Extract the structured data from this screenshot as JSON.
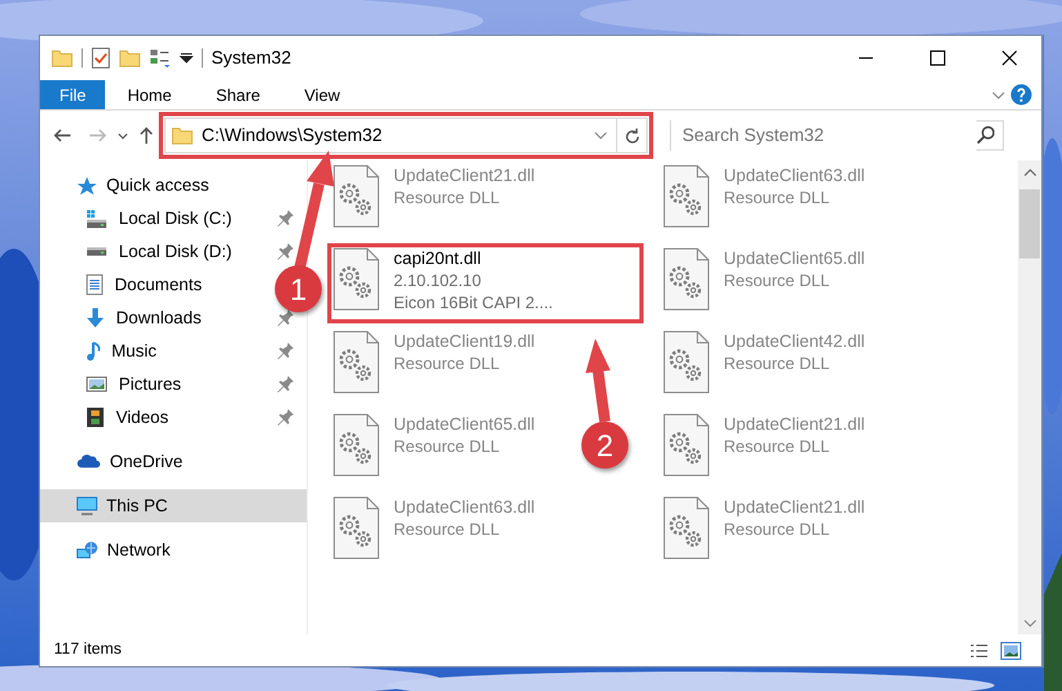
{
  "window": {
    "title": "System32"
  },
  "ribbon": {
    "tabs": [
      {
        "label": "File",
        "kind": "file"
      },
      {
        "label": "Home",
        "kind": "tab"
      },
      {
        "label": "Share",
        "kind": "tab"
      },
      {
        "label": "View",
        "kind": "tab"
      }
    ]
  },
  "address": {
    "path": "C:\\Windows\\System32",
    "search_placeholder": "Search System32",
    "highlighted": true
  },
  "sidebar": {
    "items": [
      {
        "label": "Quick access",
        "selected": false,
        "children": [
          {
            "label": "Local Disk (C:)",
            "pinned": true
          },
          {
            "label": "Local Disk (D:)",
            "pinned": true
          },
          {
            "label": "Documents",
            "pinned": false
          },
          {
            "label": "Downloads",
            "pinned": true
          },
          {
            "label": "Music",
            "pinned": true
          },
          {
            "label": "Pictures",
            "pinned": true
          },
          {
            "label": "Videos",
            "pinned": true
          }
        ]
      },
      {
        "label": "OneDrive",
        "selected": false
      },
      {
        "label": "This PC",
        "selected": true
      },
      {
        "label": "Network",
        "selected": false
      }
    ]
  },
  "files": [
    {
      "name": "UpdateClient21.dll",
      "lines": [
        "Resource DLL"
      ],
      "blurred": true,
      "highlighted": false
    },
    {
      "name": "UpdateClient63.dll",
      "lines": [
        "Resource DLL"
      ],
      "blurred": true,
      "highlighted": false
    },
    {
      "name": "capi20nt.dll",
      "lines": [
        "2.10.102.10",
        "Eicon 16Bit CAPI 2...."
      ],
      "blurred": false,
      "highlighted": true
    },
    {
      "name": "UpdateClient65.dll",
      "lines": [
        "Resource DLL"
      ],
      "blurred": true,
      "highlighted": false
    },
    {
      "name": "UpdateClient19.dll",
      "lines": [
        "Resource DLL"
      ],
      "blurred": true,
      "highlighted": false
    },
    {
      "name": "UpdateClient42.dll",
      "lines": [
        "Resource DLL"
      ],
      "blurred": true,
      "highlighted": false
    },
    {
      "name": "UpdateClient65.dll",
      "lines": [
        "Resource DLL"
      ],
      "blurred": true,
      "highlighted": false
    },
    {
      "name": "UpdateClient21.dll",
      "lines": [
        "Resource DLL"
      ],
      "blurred": true,
      "highlighted": false
    },
    {
      "name": "UpdateClient63.dll",
      "lines": [
        "Resource DLL"
      ],
      "blurred": true,
      "highlighted": false
    },
    {
      "name": "UpdateClient21.dll",
      "lines": [
        "Resource DLL"
      ],
      "blurred": true,
      "highlighted": false
    }
  ],
  "status_bar": {
    "count": "117 items"
  },
  "callouts": [
    {
      "number": "1"
    },
    {
      "number": "2"
    }
  ]
}
